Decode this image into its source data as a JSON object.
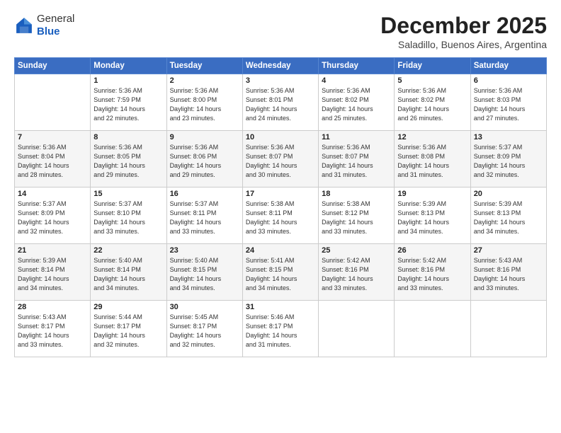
{
  "logo": {
    "general": "General",
    "blue": "Blue"
  },
  "header": {
    "month": "December 2025",
    "location": "Saladillo, Buenos Aires, Argentina"
  },
  "days_of_week": [
    "Sunday",
    "Monday",
    "Tuesday",
    "Wednesday",
    "Thursday",
    "Friday",
    "Saturday"
  ],
  "weeks": [
    [
      {
        "day": "",
        "info": ""
      },
      {
        "day": "1",
        "info": "Sunrise: 5:36 AM\nSunset: 7:59 PM\nDaylight: 14 hours\nand 22 minutes."
      },
      {
        "day": "2",
        "info": "Sunrise: 5:36 AM\nSunset: 8:00 PM\nDaylight: 14 hours\nand 23 minutes."
      },
      {
        "day": "3",
        "info": "Sunrise: 5:36 AM\nSunset: 8:01 PM\nDaylight: 14 hours\nand 24 minutes."
      },
      {
        "day": "4",
        "info": "Sunrise: 5:36 AM\nSunset: 8:02 PM\nDaylight: 14 hours\nand 25 minutes."
      },
      {
        "day": "5",
        "info": "Sunrise: 5:36 AM\nSunset: 8:02 PM\nDaylight: 14 hours\nand 26 minutes."
      },
      {
        "day": "6",
        "info": "Sunrise: 5:36 AM\nSunset: 8:03 PM\nDaylight: 14 hours\nand 27 minutes."
      }
    ],
    [
      {
        "day": "7",
        "info": "Sunrise: 5:36 AM\nSunset: 8:04 PM\nDaylight: 14 hours\nand 28 minutes."
      },
      {
        "day": "8",
        "info": "Sunrise: 5:36 AM\nSunset: 8:05 PM\nDaylight: 14 hours\nand 29 minutes."
      },
      {
        "day": "9",
        "info": "Sunrise: 5:36 AM\nSunset: 8:06 PM\nDaylight: 14 hours\nand 29 minutes."
      },
      {
        "day": "10",
        "info": "Sunrise: 5:36 AM\nSunset: 8:07 PM\nDaylight: 14 hours\nand 30 minutes."
      },
      {
        "day": "11",
        "info": "Sunrise: 5:36 AM\nSunset: 8:07 PM\nDaylight: 14 hours\nand 31 minutes."
      },
      {
        "day": "12",
        "info": "Sunrise: 5:36 AM\nSunset: 8:08 PM\nDaylight: 14 hours\nand 31 minutes."
      },
      {
        "day": "13",
        "info": "Sunrise: 5:37 AM\nSunset: 8:09 PM\nDaylight: 14 hours\nand 32 minutes."
      }
    ],
    [
      {
        "day": "14",
        "info": "Sunrise: 5:37 AM\nSunset: 8:09 PM\nDaylight: 14 hours\nand 32 minutes."
      },
      {
        "day": "15",
        "info": "Sunrise: 5:37 AM\nSunset: 8:10 PM\nDaylight: 14 hours\nand 33 minutes."
      },
      {
        "day": "16",
        "info": "Sunrise: 5:37 AM\nSunset: 8:11 PM\nDaylight: 14 hours\nand 33 minutes."
      },
      {
        "day": "17",
        "info": "Sunrise: 5:38 AM\nSunset: 8:11 PM\nDaylight: 14 hours\nand 33 minutes."
      },
      {
        "day": "18",
        "info": "Sunrise: 5:38 AM\nSunset: 8:12 PM\nDaylight: 14 hours\nand 33 minutes."
      },
      {
        "day": "19",
        "info": "Sunrise: 5:39 AM\nSunset: 8:13 PM\nDaylight: 14 hours\nand 34 minutes."
      },
      {
        "day": "20",
        "info": "Sunrise: 5:39 AM\nSunset: 8:13 PM\nDaylight: 14 hours\nand 34 minutes."
      }
    ],
    [
      {
        "day": "21",
        "info": "Sunrise: 5:39 AM\nSunset: 8:14 PM\nDaylight: 14 hours\nand 34 minutes."
      },
      {
        "day": "22",
        "info": "Sunrise: 5:40 AM\nSunset: 8:14 PM\nDaylight: 14 hours\nand 34 minutes."
      },
      {
        "day": "23",
        "info": "Sunrise: 5:40 AM\nSunset: 8:15 PM\nDaylight: 14 hours\nand 34 minutes."
      },
      {
        "day": "24",
        "info": "Sunrise: 5:41 AM\nSunset: 8:15 PM\nDaylight: 14 hours\nand 34 minutes."
      },
      {
        "day": "25",
        "info": "Sunrise: 5:42 AM\nSunset: 8:16 PM\nDaylight: 14 hours\nand 33 minutes."
      },
      {
        "day": "26",
        "info": "Sunrise: 5:42 AM\nSunset: 8:16 PM\nDaylight: 14 hours\nand 33 minutes."
      },
      {
        "day": "27",
        "info": "Sunrise: 5:43 AM\nSunset: 8:16 PM\nDaylight: 14 hours\nand 33 minutes."
      }
    ],
    [
      {
        "day": "28",
        "info": "Sunrise: 5:43 AM\nSunset: 8:17 PM\nDaylight: 14 hours\nand 33 minutes."
      },
      {
        "day": "29",
        "info": "Sunrise: 5:44 AM\nSunset: 8:17 PM\nDaylight: 14 hours\nand 32 minutes."
      },
      {
        "day": "30",
        "info": "Sunrise: 5:45 AM\nSunset: 8:17 PM\nDaylight: 14 hours\nand 32 minutes."
      },
      {
        "day": "31",
        "info": "Sunrise: 5:46 AM\nSunset: 8:17 PM\nDaylight: 14 hours\nand 31 minutes."
      },
      {
        "day": "",
        "info": ""
      },
      {
        "day": "",
        "info": ""
      },
      {
        "day": "",
        "info": ""
      }
    ]
  ]
}
